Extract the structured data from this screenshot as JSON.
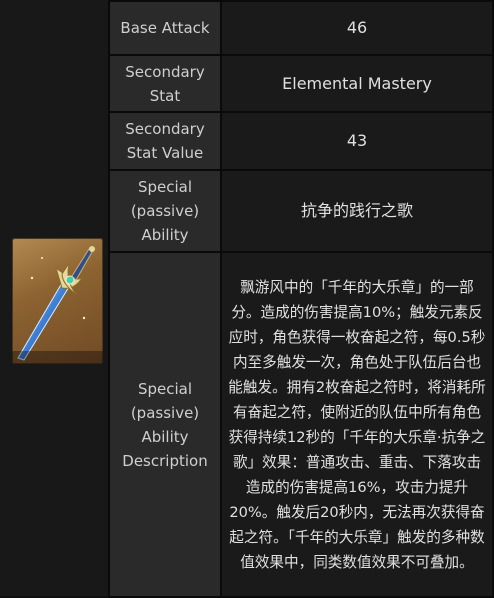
{
  "rows": [
    {
      "label": "Base Attack",
      "value": "46"
    },
    {
      "label": "Secondary Stat",
      "value": "Elemental Mastery"
    },
    {
      "label": "Secondary Stat Value",
      "value": "43"
    },
    {
      "label": "Special (passive) Ability",
      "value": "抗争的践行之歌"
    },
    {
      "label": "Special (passive) Ability Description",
      "value": "飘游风中的「千年的大乐章」的一部分。造成的伤害提高10%；触发元素反应时，角色获得一枚奋起之符，每0.5秒内至多触发一次，角色处于队伍后台也能触发。拥有2枚奋起之符时，将消耗所有奋起之符，使附近的队伍中所有角色获得持续12秒的「千年的大乐章·抗争之歌」效果：普通攻击、重击、下落攻击造成的伤害提高16%，攻击力提升20%。触发后20秒内，无法再次获得奋起之符。「千年的大乐章」触发的多种数值效果中，同类数值效果不可叠加。"
    }
  ],
  "image": {
    "name": "weapon-sword-image",
    "colors": {
      "frame": "#b38a52",
      "blade": "#3f7fd6"
    }
  }
}
